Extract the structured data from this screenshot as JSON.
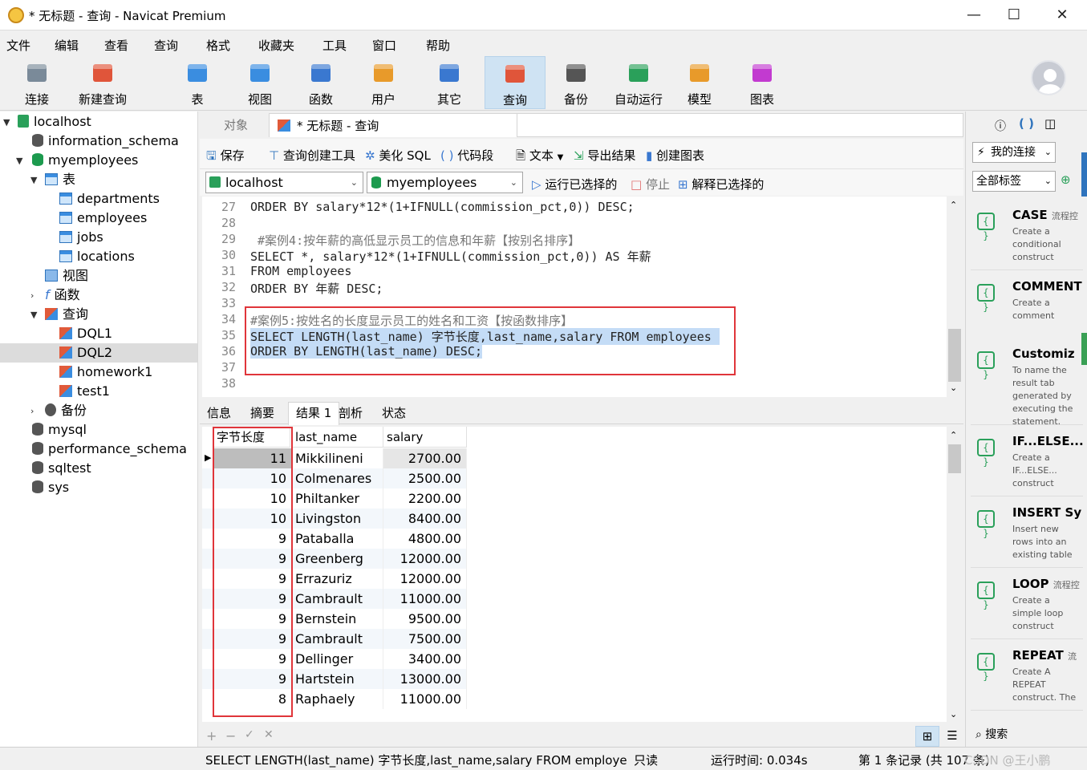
{
  "window": {
    "title": "* 无标题 - 查询 - Navicat Premium",
    "minimize": "—",
    "maximize": "☐",
    "close": "✕"
  },
  "menu": [
    "文件",
    "编辑",
    "查看",
    "查询",
    "格式",
    "收藏夹",
    "工具",
    "窗口",
    "帮助"
  ],
  "toolbar": [
    {
      "label": "连接",
      "icon": "plug-icon",
      "color": "#7a8a99"
    },
    {
      "label": "新建查询",
      "icon": "new-query-icon",
      "color": "#e0553a"
    },
    {
      "label": "表",
      "icon": "table-icon",
      "color": "#3a8de0"
    },
    {
      "label": "视图",
      "icon": "view-icon",
      "color": "#3a8de0"
    },
    {
      "label": "函数",
      "icon": "function-icon",
      "color": "#3a78d0"
    },
    {
      "label": "用户",
      "icon": "user-icon",
      "color": "#e89a2a"
    },
    {
      "label": "其它",
      "icon": "tools-icon",
      "color": "#3a78d0"
    },
    {
      "label": "查询",
      "icon": "query-icon",
      "color": "#e0553a"
    },
    {
      "label": "备份",
      "icon": "backup-icon",
      "color": "#555555"
    },
    {
      "label": "自动运行",
      "icon": "robot-icon",
      "color": "#2aa05a"
    },
    {
      "label": "模型",
      "icon": "model-icon",
      "color": "#e89a2a"
    },
    {
      "label": "图表",
      "icon": "chart-icon",
      "color": "#c23ad0"
    }
  ],
  "tree": {
    "connection": "localhost",
    "databases_top": [
      "information_schema",
      "myemployees"
    ],
    "tables_group": "表",
    "tables": [
      "departments",
      "employees",
      "jobs",
      "locations"
    ],
    "views": "视图",
    "functions": "函数",
    "queries_group": "查询",
    "queries": [
      "DQL1",
      "DQL2",
      "homework1",
      "test1"
    ],
    "backup": "备份",
    "databases_bottom": [
      "mysql",
      "performance_schema",
      "sqltest",
      "sys"
    ]
  },
  "doc_tabs": {
    "objects": "对象",
    "query": "* 无标题 - 查询"
  },
  "query_toolbar": {
    "save": "保存",
    "builder": "查询创建工具",
    "beautify": "美化 SQL",
    "snippet": "代码段",
    "text": "文本",
    "export": "导出结果",
    "chart": "创建图表"
  },
  "selectors": {
    "connection": "localhost",
    "database": "myemployees",
    "run": "运行已选择的",
    "stop": "停止",
    "explain": "解释已选择的"
  },
  "editor": {
    "line_numbers": [
      "27",
      "28",
      "29",
      "30",
      "31",
      "32",
      "33",
      "34",
      "35",
      "36",
      "37",
      "38"
    ],
    "lines": [
      "ORDER BY salary*12*(1+IFNULL(commission_pct,0)) DESC;",
      "",
      " #案例4:按年薪的高低显示员工的信息和年薪【按别名排序】",
      "SELECT *, salary*12*(1+IFNULL(commission_pct,0)) AS 年薪",
      "FROM employees",
      "ORDER BY 年薪 DESC;",
      "",
      "#案例5:按姓名的长度显示员工的姓名和工资【按函数排序】",
      "SELECT LENGTH(last_name) 字节长度,last_name,salary FROM employees",
      "ORDER BY LENGTH(last_name) DESC;",
      "",
      ""
    ]
  },
  "result_tabs": [
    "信息",
    "摘要",
    "结果 1",
    "剖析",
    "状态"
  ],
  "grid": {
    "columns": [
      "字节长度",
      "last_name",
      "salary"
    ],
    "rows": [
      [
        "11",
        "Mikkilineni",
        "2700.00"
      ],
      [
        "10",
        "Colmenares",
        "2500.00"
      ],
      [
        "10",
        "Philtanker",
        "2200.00"
      ],
      [
        "10",
        "Livingston",
        "8400.00"
      ],
      [
        "9",
        "Pataballa",
        "4800.00"
      ],
      [
        "9",
        "Greenberg",
        "12000.00"
      ],
      [
        "9",
        "Errazuriz",
        "12000.00"
      ],
      [
        "9",
        "Cambrault",
        "11000.00"
      ],
      [
        "9",
        "Bernstein",
        "9500.00"
      ],
      [
        "9",
        "Cambrault",
        "7500.00"
      ],
      [
        "9",
        "Dellinger",
        "3400.00"
      ],
      [
        "9",
        "Hartstein",
        "13000.00"
      ],
      [
        "8",
        "Raphaely",
        "11000.00"
      ]
    ]
  },
  "grid_footer": {
    "add": "+",
    "remove": "−",
    "apply": "✓",
    "discard": "✕"
  },
  "status": {
    "sql": "SELECT LENGTH(last_name) 字节长度,last_name,salary FROM employees (",
    "readonly": "只读",
    "runtime": "运行时间: 0.034s",
    "records": "第 1 条记录 (共 107 条)",
    "watermark": "CSDN @王小鹏"
  },
  "right_panel": {
    "my_connection": "我的连接",
    "tags": "全部标签",
    "snippets": [
      {
        "name": "CASE",
        "sub": "流程控",
        "desc": "Create a conditional construct"
      },
      {
        "name": "COMMENT",
        "sub": "",
        "desc": "Create a comment"
      },
      {
        "name": "Customiz",
        "sub": "",
        "desc": "To name the result tab generated by executing the statement."
      },
      {
        "name": "IF...ELSE...",
        "sub": "",
        "desc": "Create a IF...ELSE... construct"
      },
      {
        "name": "INSERT Sy",
        "sub": "",
        "desc": "Insert new rows into an existing table"
      },
      {
        "name": "LOOP",
        "sub": "流程控",
        "desc": "Create a simple loop construct"
      },
      {
        "name": "REPEAT",
        "sub": "流",
        "desc": "Create A REPEAT construct. The"
      }
    ],
    "search": "搜索"
  }
}
